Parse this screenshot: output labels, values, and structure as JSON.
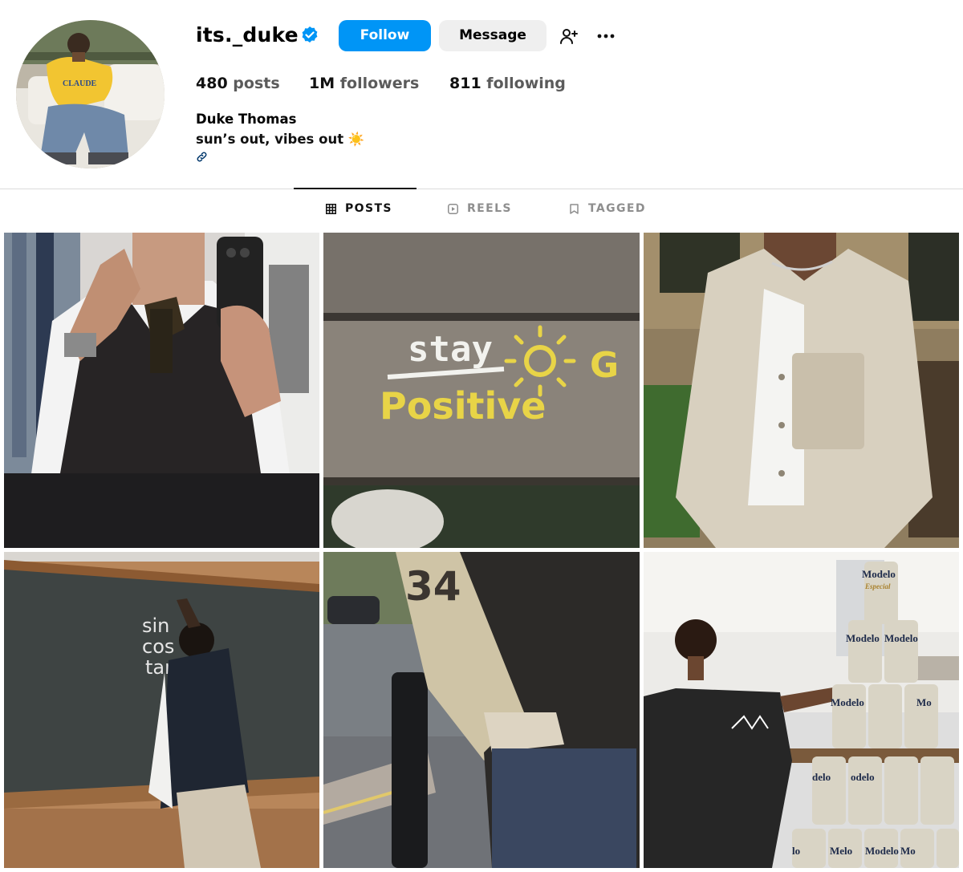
{
  "profile": {
    "username": "its._duke",
    "verified": true,
    "buttons": {
      "follow": "Follow",
      "message": "Message"
    },
    "icons": {
      "add_user": "person-add-icon",
      "more": "more-options-icon",
      "link": "link-icon",
      "verified": "verified-badge-icon"
    },
    "stats": {
      "posts_count": "480",
      "posts_label": "posts",
      "followers_count": "1M",
      "followers_label": "followers",
      "following_count": "811",
      "following_label": "following"
    },
    "full_name": "Duke Thomas",
    "bio_text": "sun’s out, vibes out",
    "bio_emoji": "☀️"
  },
  "tabs": [
    {
      "label": "POSTS",
      "icon": "grid-icon",
      "active": true
    },
    {
      "label": "REELS",
      "icon": "reels-icon",
      "active": false
    },
    {
      "label": "TAGGED",
      "icon": "tagged-icon",
      "active": false
    }
  ],
  "posts": [
    {
      "image": "mirror-selfie-sweater-vest",
      "caption_text": []
    },
    {
      "image": "bench-painted-message",
      "caption_text": [
        "stay",
        "Positive",
        "G"
      ]
    },
    {
      "image": "beige-overshirt-outfit",
      "caption_text": []
    },
    {
      "image": "chalkboard-trig-functions",
      "caption_text": [
        "sin",
        "cos",
        "tan"
      ]
    },
    {
      "image": "varsity-jacket-street",
      "caption_text": [
        "34"
      ]
    },
    {
      "image": "beer-can-pyramid-kitchen",
      "caption_text": [
        "Modelo",
        "Especial",
        "Modelo",
        "Modelo",
        "delo",
        "Modelo",
        "Mo",
        "lo",
        "Melo",
        "Modelo",
        "Mo",
        "odelo"
      ]
    }
  ],
  "colors": {
    "follow_bg": "#0095f6",
    "message_bg": "#efefef",
    "verified": "#0095f6",
    "muted": "#8e8e8e"
  }
}
